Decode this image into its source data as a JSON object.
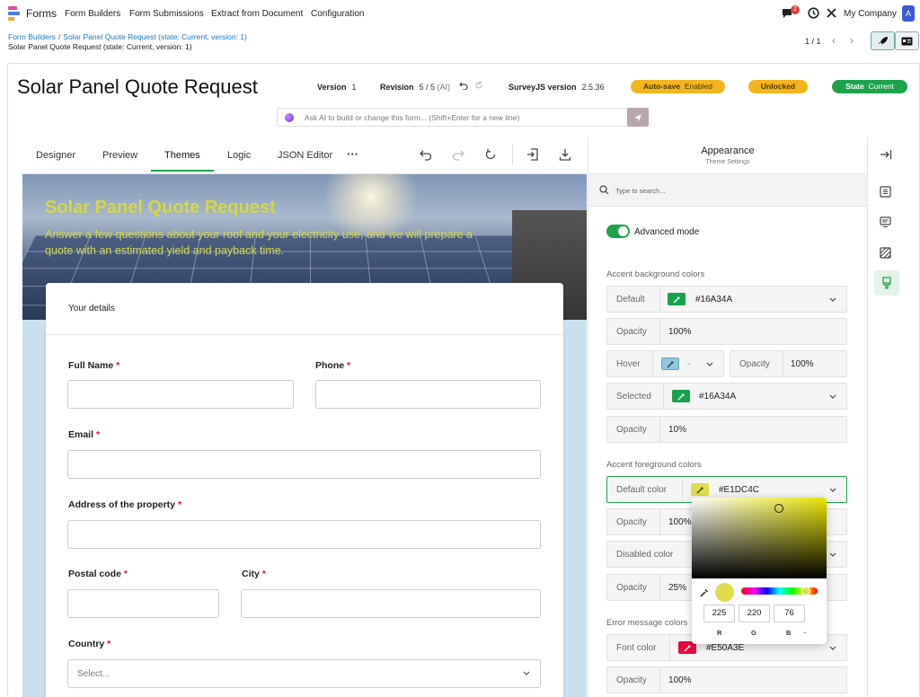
{
  "app": {
    "brand": "Forms",
    "nav": [
      "Form Builders",
      "Form Submissions",
      "Extract from Document",
      "Configuration"
    ],
    "notif_count": "2",
    "company": "My Company",
    "avatar_initial": "A"
  },
  "breadcrumb": {
    "root": "Form Builders",
    "sep": "/",
    "current": "Solar Panel Quote Request (state: Current, version: 1)",
    "subtitle": "Solar Panel Quote Request (state: Current, version: 1)"
  },
  "pager": {
    "label": "1 / 1"
  },
  "form_header": {
    "title": "Solar Panel Quote Request",
    "version_label": "Version",
    "version_value": "1",
    "revision_label": "Revision",
    "revision_value": "5 / 5",
    "revision_ai": "(AI)",
    "surveyjs_label": "SurveyJS version",
    "surveyjs_value": "2.5.36",
    "autosave_label": "Auto-save",
    "autosave_value": "Enabled",
    "lock_label": "Unlocked",
    "state_label": "State",
    "state_value": "Current"
  },
  "ai": {
    "placeholder": "Ask AI to build or change this form... (Shift+Enter for a new line)"
  },
  "tabs": [
    "Designer",
    "Preview",
    "Themes",
    "Logic",
    "JSON Editor",
    "···"
  ],
  "active_tab": "Themes",
  "survey": {
    "title": "Solar Panel Quote Request",
    "description": "Answer a few questions about your roof and your electricity use, and we will prepare a quote with an estimated yield and payback time.",
    "section_title": "Your details",
    "required_mark": "*",
    "fields": {
      "full_name": "Full Name",
      "phone": "Phone",
      "email": "Email",
      "address": "Address of the property",
      "postal_code": "Postal code",
      "city": "City",
      "country": "Country",
      "country_placeholder": "Select..."
    }
  },
  "panel": {
    "title": "Appearance",
    "subtitle": "Theme Settings",
    "search_placeholder": "Type to search...",
    "advanced_mode": "Advanced mode",
    "accent_bg": {
      "heading": "Accent background colors",
      "default_label": "Default",
      "default_value": "#16A34A",
      "opacity_label": "Opacity",
      "opacity_value": "100%",
      "hover_label": "Hover",
      "hover_value": "-",
      "hover_opacity_label": "Opacity",
      "hover_opacity_value": "100%",
      "selected_label": "Selected",
      "selected_value": "#16A34A",
      "selected_opacity_label": "Opacity",
      "selected_opacity_value": "10%"
    },
    "accent_fg": {
      "heading": "Accent foreground colors",
      "default_label": "Default color",
      "default_value": "#E1DC4C",
      "opacity_label": "Opacity",
      "opacity_value": "100%",
      "disabled_label": "Disabled color",
      "disabled_opacity_label": "Opacity",
      "disabled_opacity_value": "25%"
    },
    "error": {
      "heading": "Error message colors",
      "font_label": "Font color",
      "font_value": "#E50A3E",
      "opacity_label": "Opacity",
      "opacity_value": "100%"
    }
  },
  "picker": {
    "r": "225",
    "g": "220",
    "b": "76",
    "r_label": "R",
    "g_label": "G",
    "b_label": "B",
    "spin": "÷"
  },
  "colors": {
    "accent_green": "#16A34A",
    "accent_yellow": "#E1DC4C",
    "error_red": "#E50A3E"
  }
}
